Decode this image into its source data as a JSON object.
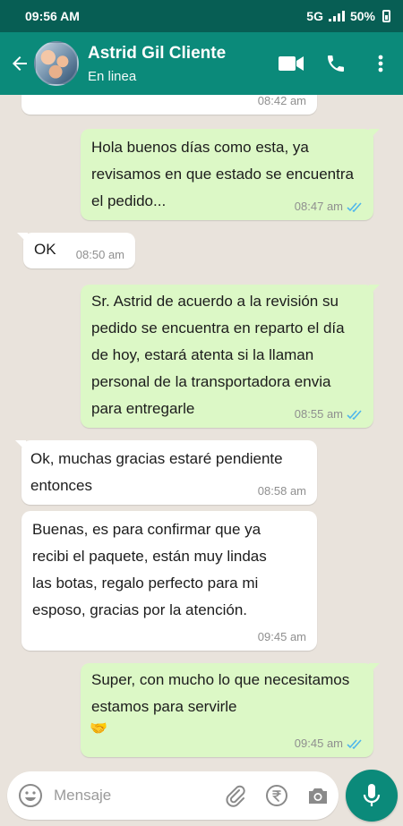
{
  "status_bar": {
    "time": "09:56 AM",
    "network": "5G",
    "battery": "50%"
  },
  "header": {
    "contact_name": "Astrid Gil Cliente",
    "contact_status": "En linea"
  },
  "messages": [
    {
      "direction": "in",
      "text": "",
      "time": "08:42 am"
    },
    {
      "direction": "out",
      "text": "Hola buenos días como esta, ya revisamos en que estado se encuentra el pedido...",
      "time": "08:47 am"
    },
    {
      "direction": "in",
      "text": "OK",
      "time": "08:50 am"
    },
    {
      "direction": "out",
      "text": "Sr. Astrid de acuerdo a la revisión su pedido se encuentra en reparto el día de hoy, estará atenta si la llaman personal de la transportadora envia para entregarle",
      "time": "08:55 am"
    },
    {
      "direction": "in",
      "text": "Ok, muchas gracias estaré pendiente entonces",
      "time": "08:58 am"
    },
    {
      "direction": "in",
      "text": "Buenas, es para confirmar que ya recibi el paquete, están muy lindas las botas, regalo perfecto para mi esposo, gracias por la atención.",
      "time": "09:45 am"
    },
    {
      "direction": "out",
      "text": "Super, con mucho lo que necesitamos estamos para servirle",
      "emoji": "🤝",
      "time": "09:45 am"
    }
  ],
  "composer": {
    "placeholder": "Mensaje"
  },
  "icons": {
    "back": "arrow-left-icon",
    "video": "video-call-icon",
    "call": "phone-icon",
    "menu": "more-vertical-icon",
    "emoji": "emoji-icon",
    "attach": "paperclip-icon",
    "payment": "rupee-icon",
    "camera": "camera-icon",
    "mic": "microphone-icon",
    "read": "double-check-icon"
  },
  "colors": {
    "header": "#0b8a7a",
    "status_bar": "#075e54",
    "outgoing": "#dcf8c6",
    "incoming": "#ffffff",
    "read_ticks": "#4fb6ec"
  }
}
